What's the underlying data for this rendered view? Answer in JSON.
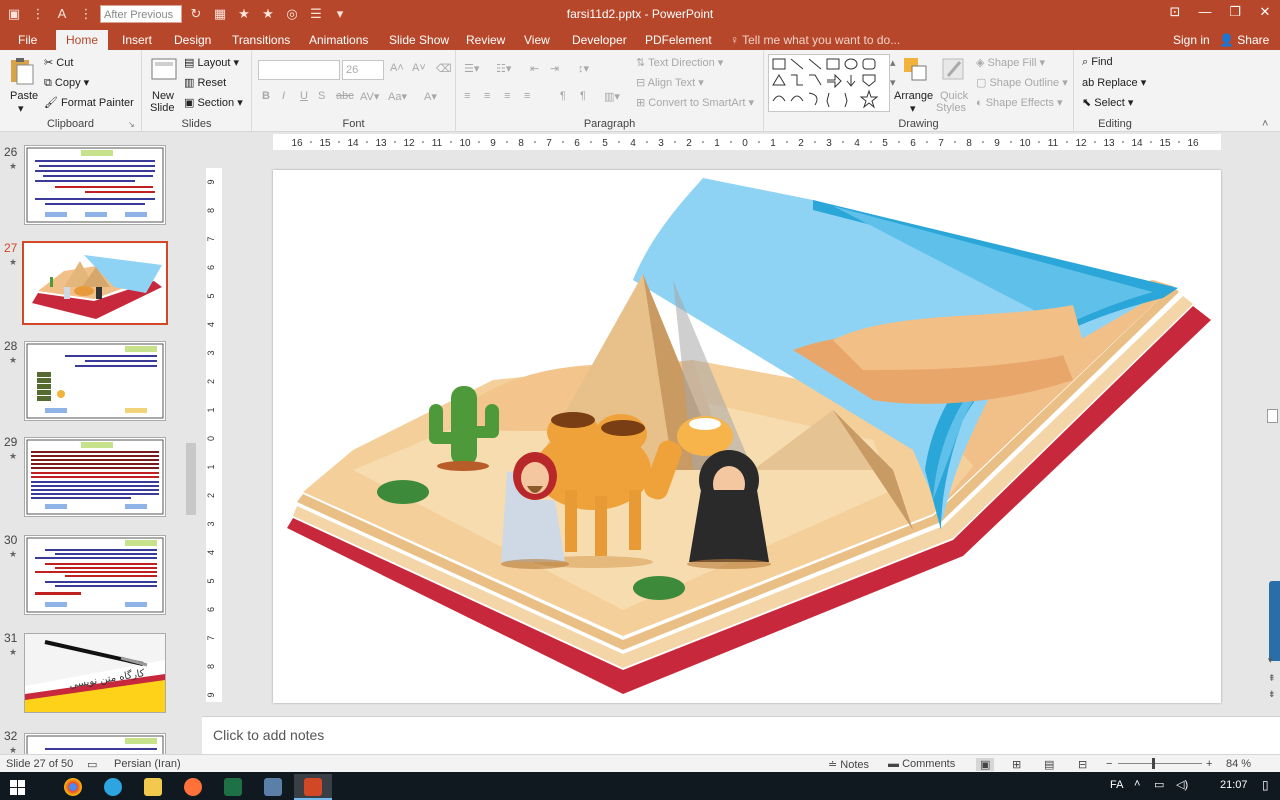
{
  "window": {
    "title": "farsi11d2.pptx - PowerPoint",
    "undo_field": "After Previous"
  },
  "tabs": [
    "File",
    "Home",
    "Insert",
    "Design",
    "Transitions",
    "Animations",
    "Slide Show",
    "Review",
    "View",
    "Developer",
    "PDFelement"
  ],
  "active_tab": "Home",
  "tell_me": "Tell me what you want to do...",
  "account": {
    "signin": "Sign in",
    "share": "Share"
  },
  "ribbon": {
    "clipboard": {
      "label": "Clipboard",
      "paste": "Paste",
      "cut": "Cut",
      "copy": "Copy",
      "format_painter": "Format Painter"
    },
    "slides": {
      "label": "Slides",
      "new_slide_1": "New",
      "new_slide_2": "Slide",
      "layout": "Layout",
      "reset": "Reset",
      "section": "Section"
    },
    "font": {
      "label": "Font",
      "size": "26"
    },
    "paragraph": {
      "label": "Paragraph",
      "text_direction": "Text Direction",
      "align_text": "Align Text",
      "convert_smartart": "Convert to SmartArt"
    },
    "drawing": {
      "label": "Drawing",
      "arrange": "Arrange",
      "quick_styles_1": "Quick",
      "quick_styles_2": "Styles",
      "shape_fill": "Shape Fill",
      "shape_outline": "Shape Outline",
      "shape_effects": "Shape Effects"
    },
    "editing": {
      "label": "Editing",
      "find": "Find",
      "replace": "Replace",
      "select": "Select"
    }
  },
  "thumbnails": [
    {
      "num": "26",
      "title": ""
    },
    {
      "num": "27",
      "title": ""
    },
    {
      "num": "28",
      "title": ""
    },
    {
      "num": "29",
      "title": ""
    },
    {
      "num": "30",
      "title": ""
    },
    {
      "num": "31",
      "title": "کارگاه متن نویسی"
    },
    {
      "num": "32",
      "title": ""
    }
  ],
  "selected_slide": "27",
  "ruler_numbers": [
    "16",
    "15",
    "14",
    "13",
    "12",
    "11",
    "10",
    "9",
    "8",
    "7",
    "6",
    "5",
    "4",
    "3",
    "2",
    "1",
    "0",
    "1",
    "2",
    "3",
    "4",
    "5",
    "6",
    "7",
    "8",
    "9",
    "10",
    "11",
    "12",
    "13",
    "14",
    "15",
    "16"
  ],
  "notes_placeholder": "Click to add notes",
  "status": {
    "slide_of": "Slide 27 of 50",
    "language": "Persian (Iran)",
    "notes": "Notes",
    "comments": "Comments",
    "zoom": "84 %"
  },
  "taskbar": {
    "lang": "FA",
    "time": "21:07"
  },
  "colors": {
    "accent": "#b7472a",
    "selected_thumb": "#d24726",
    "book_cover": "#c8283c",
    "sky": "#8fd3f4"
  }
}
